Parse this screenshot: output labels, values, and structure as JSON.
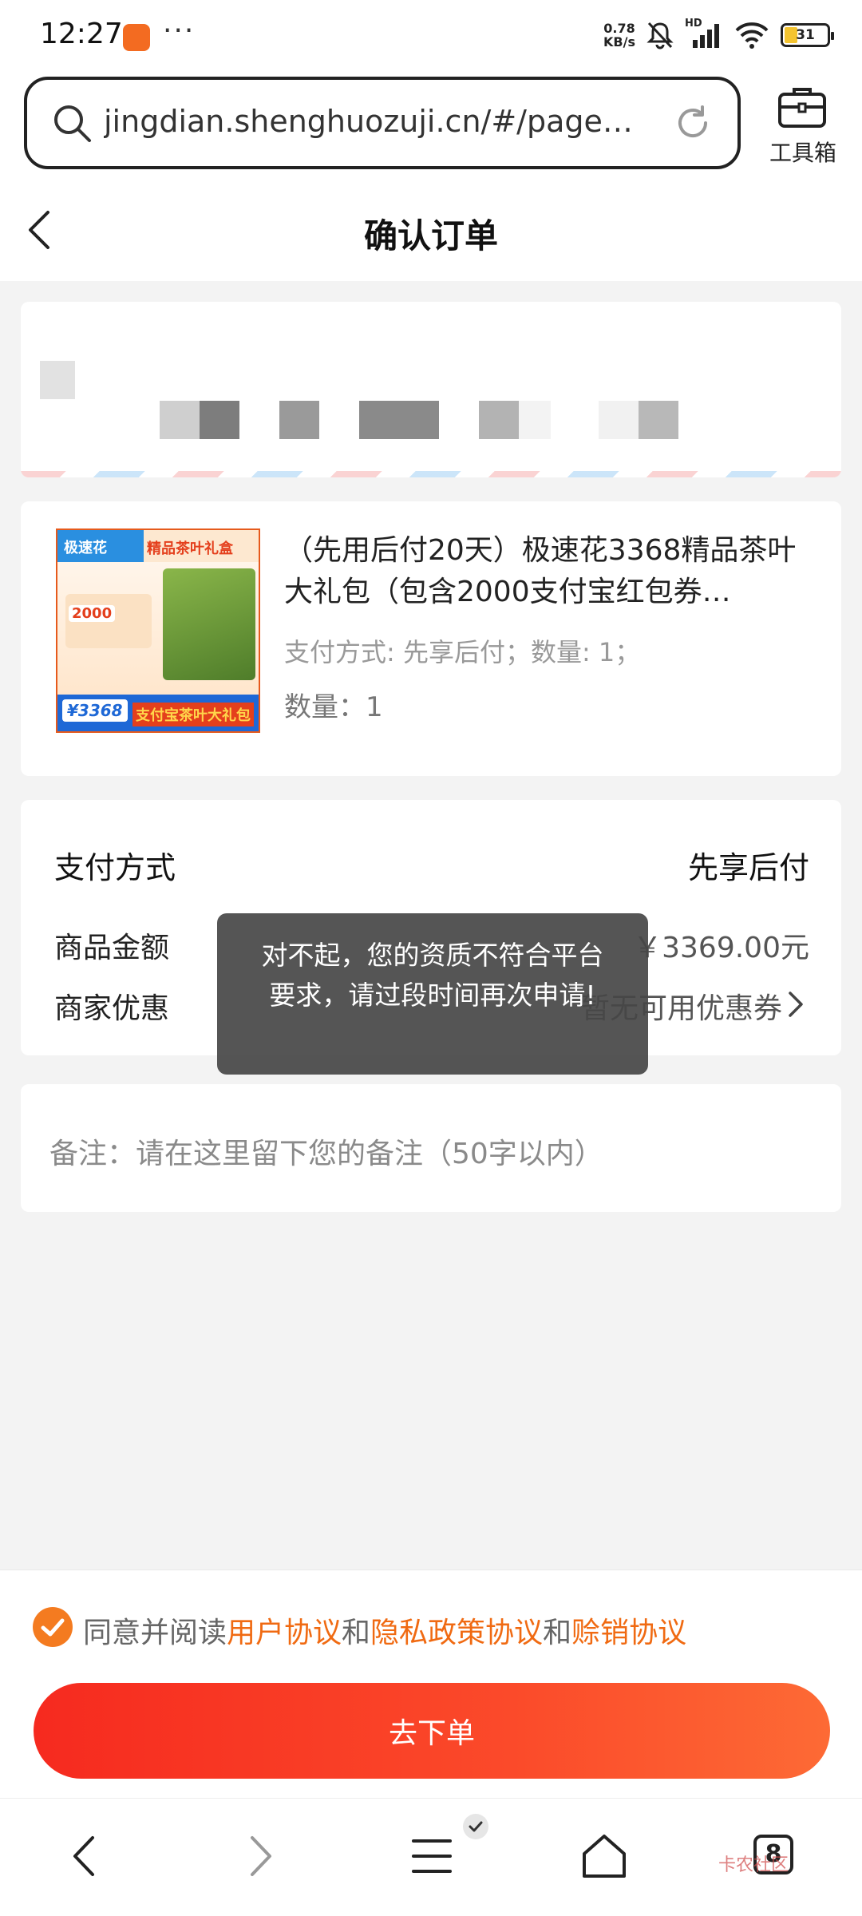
{
  "status_bar": {
    "time": "12:27",
    "dots": "···",
    "net_speed_value": "0.78",
    "net_speed_unit": "KB/s",
    "signal_label": "HD",
    "battery_level": 31,
    "battery_label": "31"
  },
  "browser": {
    "url": "jingdian.shenghuozuji.cn/#/pages/ch...",
    "toolbox_label": "工具箱",
    "tab_count": "8"
  },
  "header": {
    "title": "确认订单"
  },
  "product": {
    "thumb_logo": "极速花",
    "thumb_title": "精品茶叶礼盒",
    "thumb_coupon": "2000",
    "thumb_price": "¥3368",
    "thumb_footer": "支付宝茶叶大礼包",
    "name": "（先用后付20天）极速花3368精品茶叶大礼包（包含2000支付宝红包券…",
    "spec": "支付方式: 先享后付；数量: 1；",
    "quantity": "数量：1"
  },
  "payment": {
    "method_label": "支付方式",
    "method_value": "先享后付",
    "amount_label": "商品金额",
    "amount_value": "￥3369.00元",
    "discount_label": "商家优惠",
    "discount_value": "暂无可用优惠券"
  },
  "note": {
    "placeholder": "备注：请在这里留下您的备注（50字以内）"
  },
  "toast": {
    "message": "对不起，您的资质不符合平台要求，请过段时间再次申请!"
  },
  "agreement": {
    "prefix": "同意并阅读",
    "link1": "用户协议",
    "and1": "和",
    "link2": "隐私政策协议",
    "and2": "和",
    "link3": "赊销协议",
    "checked": true
  },
  "actions": {
    "submit_label": "去下单"
  },
  "watermark": "卡农社区",
  "colors": {
    "accent": "#f06a12",
    "button_start": "#f62a1f",
    "button_end": "#fd6a35",
    "toast_bg": "#464646"
  }
}
